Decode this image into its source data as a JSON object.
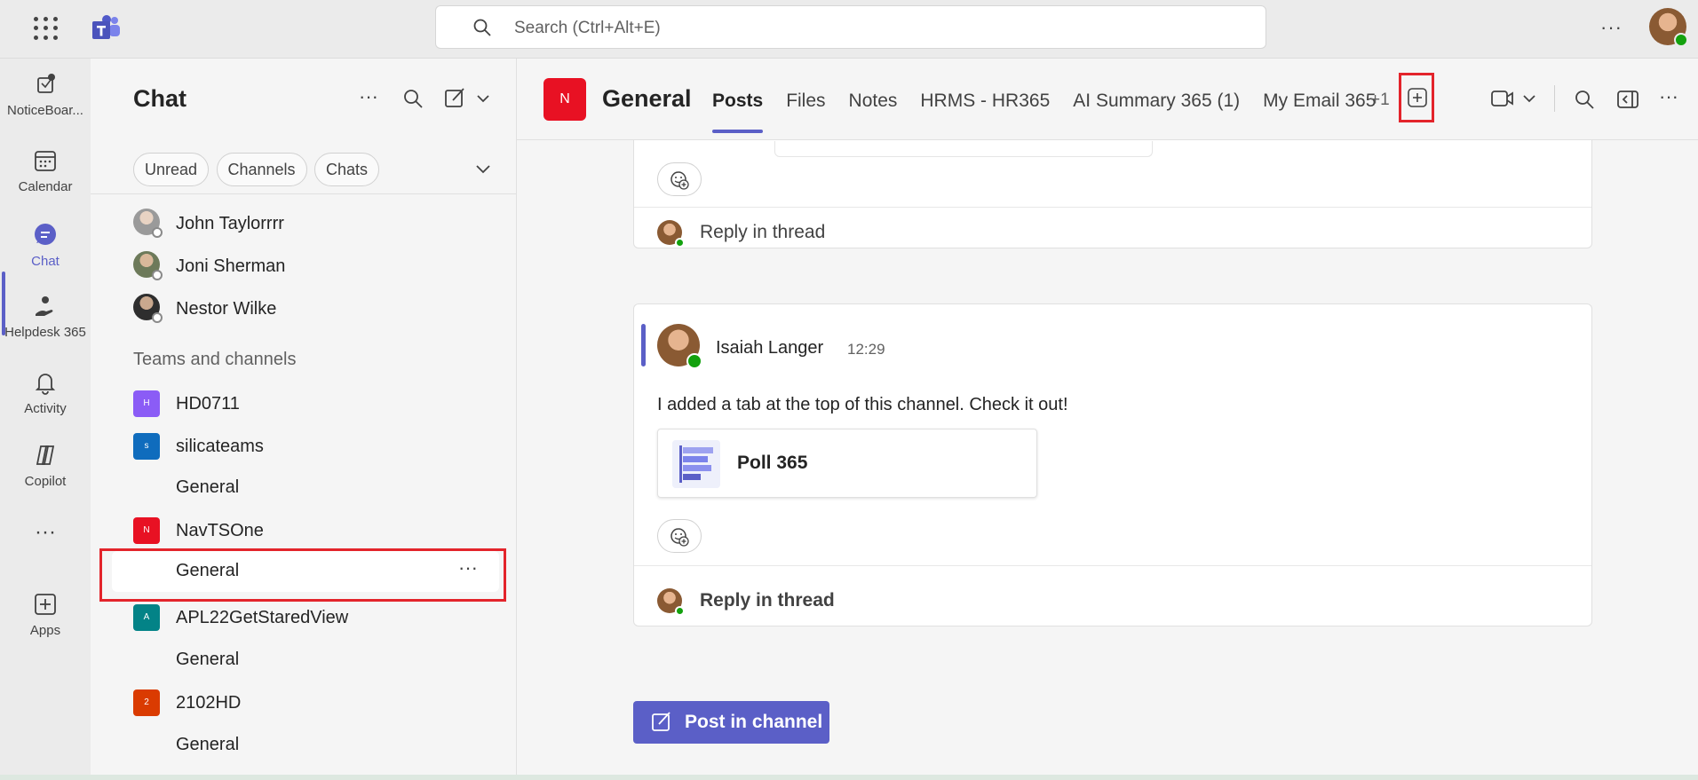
{
  "topbar": {
    "search_placeholder": "Search (Ctrl+Alt+E)",
    "more_label": "···"
  },
  "rail": {
    "items": [
      {
        "label": "NoticeBoar...",
        "icon": "noticeboard-icon"
      },
      {
        "label": "Calendar",
        "icon": "calendar-icon"
      },
      {
        "label": "Chat",
        "icon": "chat-icon",
        "active": true
      },
      {
        "label": "Helpdesk 365",
        "icon": "helpdesk-icon"
      },
      {
        "label": "Activity",
        "icon": "bell-icon"
      },
      {
        "label": "Copilot",
        "icon": "copilot-icon"
      },
      {
        "label": "···",
        "icon": "more-icon"
      },
      {
        "label": "Apps",
        "icon": "apps-icon"
      }
    ]
  },
  "chatpane": {
    "title": "Chat",
    "more_label": "···",
    "filters": [
      "Unread",
      "Channels",
      "Chats"
    ],
    "contacts": [
      "John Taylorrrr",
      "Joni Sherman",
      "Nestor Wilke"
    ],
    "section_label": "Teams and channels",
    "teams": [
      {
        "name": "HD0711",
        "initial": "H",
        "color": "#8b5cf6"
      },
      {
        "name": "silicateams",
        "initial": "s",
        "color": "#0f6cbd",
        "channels": [
          "General"
        ]
      },
      {
        "name": "NavTSOne",
        "initial": "N",
        "color": "#e81123",
        "channels": [
          "General"
        ]
      },
      {
        "name": "APL22GetStaredView",
        "initial": "A",
        "color": "#038387",
        "channels": [
          "General"
        ]
      },
      {
        "name": "2102HD",
        "initial": "2",
        "color": "#da3b01",
        "channels": [
          "General"
        ]
      }
    ],
    "selected_more": "···"
  },
  "channel": {
    "initial": "N",
    "name": "General",
    "tabs": [
      "Posts",
      "Files",
      "Notes",
      "HRMS - HR365",
      "AI Summary 365 (1)",
      "My Email 365"
    ],
    "tabs_more": "+1",
    "more_label": "···"
  },
  "feed": {
    "reply_label": "Reply in thread",
    "message": {
      "author": "Isaiah Langer",
      "time": "12:29",
      "text": "I added a tab at the top of this channel. Check it out!",
      "card_title": "Poll 365"
    },
    "post_button": "Post in channel"
  },
  "colors": {
    "accent": "#5b5fc7",
    "highlight": "#e3242b",
    "presence_available": "#13a10e"
  }
}
